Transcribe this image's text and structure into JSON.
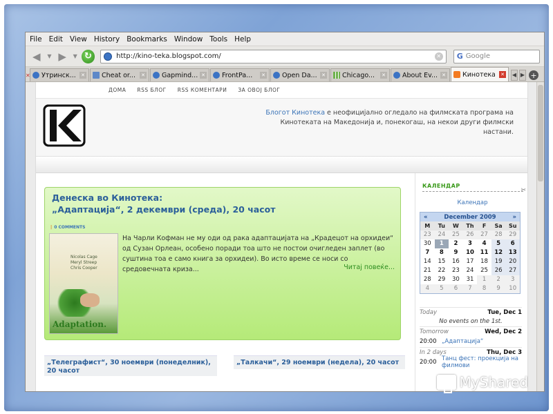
{
  "menubar": [
    "File",
    "Edit",
    "View",
    "History",
    "Bookmarks",
    "Window",
    "Tools",
    "Help"
  ],
  "navbar": {
    "url": "http://kino-teka.blogspot.com/",
    "search_placeholder": "Google"
  },
  "tabs": [
    {
      "label": "Утринск...",
      "icon": "globe-icon",
      "active": false
    },
    {
      "label": "Cheat or...",
      "icon": "page-icon",
      "active": false
    },
    {
      "label": "Gapmind...",
      "icon": "globe-icon",
      "active": false
    },
    {
      "label": "FrontPa...",
      "icon": "globe-icon",
      "active": false
    },
    {
      "label": "Open Da...",
      "icon": "globe-icon",
      "active": false
    },
    {
      "label": "Chicago...",
      "icon": "grid-icon",
      "active": false
    },
    {
      "label": "About Ev...",
      "icon": "globe-icon",
      "active": false
    },
    {
      "label": "Кинотека",
      "icon": "blogger-icon",
      "active": true
    }
  ],
  "site": {
    "nav": [
      "ДОМА",
      "RSS БЛОГ",
      "RSS КОМЕНТАРИ",
      "ЗА ОВОЈ БЛОГ"
    ],
    "desc_link": "Блогот Кинотека",
    "desc_text": " е неофицијално огледало на филмската програма на Кинотеката на Македонија и, понекогаш, на некои други филмски настани."
  },
  "post": {
    "title_line1": "Денеска во Кинотека:",
    "title_line2": "„Адаптација“, 2 декември (среда), 20 часот",
    "comments": "0 COMMENTS",
    "body": "На Чарли Кофман не му оди од рака адаптацијата на „Крадецот на орхидеи“ од Сузан Орлеан, особено поради тоа што не постои очигледен заплет (во суштина тоа е само книга за орхидеи). Во исто време се носи со средовечната криза...",
    "readmore": "Читај повеќе...",
    "poster_title": "Adaptation.",
    "poster_cast": [
      "Nicolas Cage",
      "Meryl Streep",
      "Chris Cooper"
    ]
  },
  "older_posts": [
    "„Телеграфист“, 30 ноември (понеделник), 20 часот",
    "„Талкачи“, 29 ноември (недела), 20 часот"
  ],
  "sidebar": {
    "title": "КАЛЕНДАР",
    "cal_link": "Календар",
    "month": "December 2009",
    "dow": [
      "M",
      "Tu",
      "W",
      "Th",
      "F",
      "Sa",
      "Su"
    ],
    "weeks": [
      [
        [
          "23",
          "out"
        ],
        [
          "24",
          "out"
        ],
        [
          "25",
          "out"
        ],
        [
          "26",
          "out"
        ],
        [
          "27",
          "out"
        ],
        [
          "28",
          "out"
        ],
        [
          "29",
          "out"
        ]
      ],
      [
        [
          "30",
          "past"
        ],
        [
          "1",
          "today"
        ],
        [
          "2",
          "in"
        ],
        [
          "3",
          "in"
        ],
        [
          "4",
          "in"
        ],
        [
          "5",
          "in"
        ],
        [
          "6",
          "in"
        ]
      ],
      [
        [
          "7",
          "in"
        ],
        [
          "8",
          "in"
        ],
        [
          "9",
          "in"
        ],
        [
          "10",
          "in"
        ],
        [
          "11",
          "in"
        ],
        [
          "12",
          "in"
        ],
        [
          "13",
          "in"
        ]
      ],
      [
        [
          "14",
          "past"
        ],
        [
          "15",
          "past"
        ],
        [
          "16",
          "past"
        ],
        [
          "17",
          "past"
        ],
        [
          "18",
          "past"
        ],
        [
          "19",
          "past"
        ],
        [
          "20",
          "past"
        ]
      ],
      [
        [
          "21",
          "past"
        ],
        [
          "22",
          "past"
        ],
        [
          "23",
          "past"
        ],
        [
          "24",
          "past"
        ],
        [
          "25",
          "past"
        ],
        [
          "26",
          "past"
        ],
        [
          "27",
          "past"
        ]
      ],
      [
        [
          "28",
          "past"
        ],
        [
          "29",
          "past"
        ],
        [
          "30",
          "past"
        ],
        [
          "31",
          "past"
        ],
        [
          "1",
          "out"
        ],
        [
          "2",
          "out"
        ],
        [
          "3",
          "out"
        ]
      ],
      [
        [
          "4",
          "out"
        ],
        [
          "5",
          "out"
        ],
        [
          "6",
          "out"
        ],
        [
          "7",
          "out"
        ],
        [
          "8",
          "out"
        ],
        [
          "9",
          "out"
        ],
        [
          "10",
          "out"
        ]
      ]
    ],
    "agenda": [
      {
        "when": "Today",
        "date": "Tue, Dec 1",
        "none": "No events on the 1st."
      },
      {
        "when": "Tomorrow",
        "date": "Wed, Dec 2",
        "time": "20:00",
        "title": "„Адаптација“"
      },
      {
        "when": "In 2 days",
        "date": "Thu, Dec 3",
        "time": "20:00",
        "title": "Танц фест: проекција на филмови"
      }
    ]
  },
  "watermark": "MyShared"
}
